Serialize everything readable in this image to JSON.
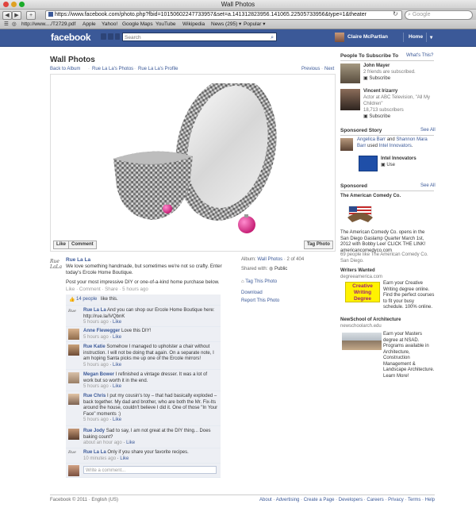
{
  "window_title": "Wall Photos",
  "url": "https://www.facebook.com/photo.php?fbid=10150602247733957&set=a.141312823956.141065.22505733956&type=1&theater",
  "google_placeholder": "Google",
  "bookmarks": [
    "http://www..../T2729.pdf",
    "Apple",
    "Yahoo!",
    "Google Maps",
    "YouTube",
    "Wikipedia",
    "News (295) ▾",
    "Popular ▾"
  ],
  "fb": {
    "logo": "facebook",
    "search_placeholder": "Search",
    "user_name": "Claire McPartlan",
    "home": "Home",
    "account_arrow": "▾"
  },
  "photo": {
    "title": "Wall Photos",
    "back": "Back to Album",
    "sep1": "·",
    "photos_link": "Rue La La's Photos",
    "sep2": "·",
    "profile_link": "Rue La La's Profile",
    "previous": "Previous",
    "next": "Next",
    "like_btn": "Like",
    "comment_btn": "Comment",
    "tag_btn": "Tag Photo"
  },
  "post": {
    "author": "Rue La La",
    "text1": "We love something handmade, but sometimes we're not so crafty. Enter today's Ercole Home Boutique.",
    "text2": "Post your most impressive DIY or one-of-a-kind home purchase below.",
    "actions": "Like · Comment · Share · 5 hours ago",
    "likes": "14 people",
    "likes_suffix": " like this.",
    "album_label": "Album:",
    "album_link": "Wall Photos",
    "album_count": "· 2 of 404",
    "shared_label": "Shared with:",
    "shared_value": "Public",
    "tag_link": "Tag This Photo",
    "download": "Download",
    "report": "Report This Photo"
  },
  "comments": [
    {
      "name": "Rue La La",
      "text": "And you can shop our Ercole Home Boutique here: http://rue.la/iVQbnK",
      "time": "5 hours ago",
      "like": "Like"
    },
    {
      "name": "Anne Flewegger",
      "text": "Love this DIY!",
      "time": "5 hours ago",
      "like": "Like"
    },
    {
      "name": "Rue Katie",
      "text": "Somehow I managed to upholster a chair without instruction. I will not be doing that again. On a separate note, I am hoping Santa picks me up one of the Ercole mirrors!",
      "time": "5 hours ago",
      "like": "Like"
    },
    {
      "name": "Megan Bower",
      "text": "I refinished a vintage dresser. It was a lot of work but so worth it in the end.",
      "time": "5 hours ago",
      "like": "Like"
    },
    {
      "name": "Rue Chris",
      "text": "I put my cousin's toy – that had basically exploded – back together. My dad and brother, who are both the Mr. Fix-Its around the house, couldn't believe I did it. One of those \"In Your Face\" moments :)",
      "time": "5 hours ago",
      "like": "Like"
    },
    {
      "name": "Rue Jody",
      "text": "Sad to say, I am not great at the DIY thing... Does baking count?",
      "time": "about an hour ago",
      "like": "Like"
    },
    {
      "name": "Rue La La",
      "text": "Only if you share your favorite recipes.",
      "time": "10 minutes ago",
      "like": "Like"
    }
  ],
  "comment_placeholder": "Write a comment...",
  "right": {
    "people_title": "People To Subscribe To",
    "whats_this": "What's This?",
    "people": [
      {
        "name": "John Mayer",
        "desc": "2 friends are subscribed.",
        "action": "Subscribe"
      },
      {
        "name": "Vincent Irizarry",
        "desc": "Actor at ABC Television, \"All My Children\"",
        "desc2": "18,713 subscribers",
        "action": "Subscribe"
      }
    ],
    "sponsored_story_title": "Sponsored Story",
    "see_all": "See All",
    "story_text_a": "Angelica Barr",
    "story_text_b": " and ",
    "story_text_c": "Shannon Mara Barr",
    "story_text_d": " used ",
    "story_text_e": "Intel Innovators",
    "story_text_f": ".",
    "intel_name": "Intel Innovators",
    "intel_use": "Use",
    "sponsored_title": "Sponsored",
    "ad1": {
      "title": "The American Comedy Co.",
      "text": "The American Comedy Co. opens in the San Diego Gaslamp Quarter March 1st, 2012 with Bobby Lee! CLICK THE LINK! americancomedyco.com",
      "likes": "69 people like The American Comedy Co. San Diego."
    },
    "ad2": {
      "title": "Writers Wanted",
      "url": "degreeamerica.com",
      "img_text": "Creative Writing Degree",
      "text": "Earn your Creative Writing degree online. Find the perfect courses to fit your busy schedule. 100% online."
    },
    "ad3": {
      "title": "NewSchool of Architecture",
      "url": "newschoolarch.edu",
      "text": "Earn your Masters degree at NSAD. Programs available in Architecture, Construction Management & Landscape Architecture. Learn More!"
    }
  },
  "footer": {
    "left": "Facebook © 2011 · English (US)",
    "links": "About · Advertising · Create a Page · Developers · Careers · Privacy · Terms · Help"
  }
}
